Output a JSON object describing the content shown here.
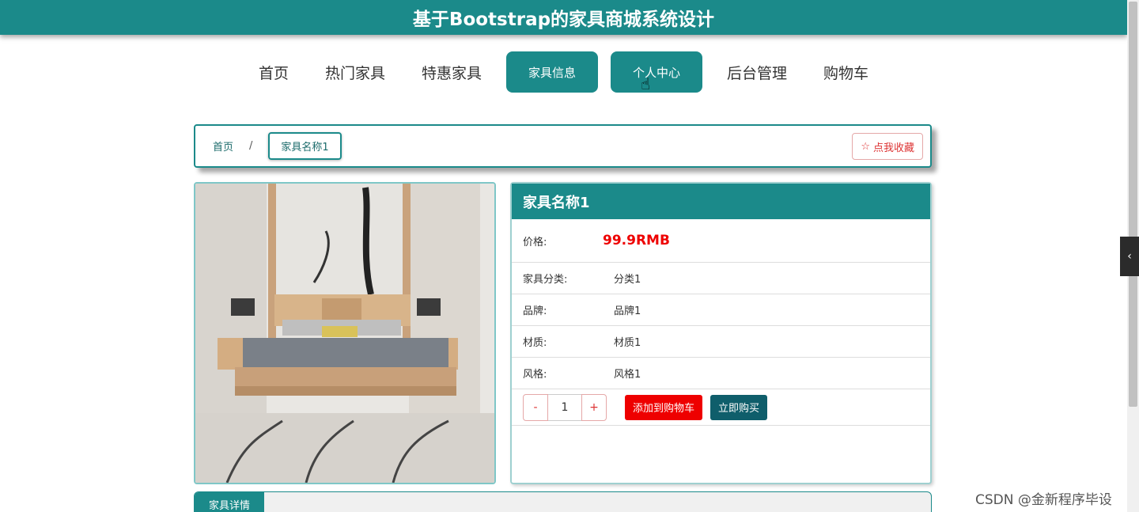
{
  "header": {
    "title": "基于Bootstrap的家具商城系统设计"
  },
  "nav": {
    "items": [
      {
        "label": "首页"
      },
      {
        "label": "热门家具"
      },
      {
        "label": "特惠家具"
      },
      {
        "label": "家具信息"
      },
      {
        "label": "个人中心"
      },
      {
        "label": "后台管理"
      },
      {
        "label": "购物车"
      }
    ]
  },
  "breadcrumb": {
    "home": "首页",
    "separator": "/",
    "current": "家具名称1",
    "favorite_label": "点我收藏"
  },
  "product": {
    "name": "家具名称1",
    "price_label": "价格:",
    "price_value": "99.9RMB",
    "attributes": [
      {
        "label": "家具分类:",
        "value": "分类1"
      },
      {
        "label": "品牌:",
        "value": "品牌1"
      },
      {
        "label": "材质:",
        "value": "材质1"
      },
      {
        "label": "风格:",
        "value": "风格1"
      }
    ],
    "quantity": "1",
    "decrement_label": "-",
    "increment_label": "+",
    "add_to_cart_label": "添加到购物车",
    "buy_now_label": "立即购买"
  },
  "details": {
    "tab_label": "家具详情"
  },
  "watermark": "CSDN @金新程序毕设",
  "colors": {
    "primary": "#1b8a8a",
    "price": "#ee0000",
    "buy": "#0f5e6b"
  }
}
